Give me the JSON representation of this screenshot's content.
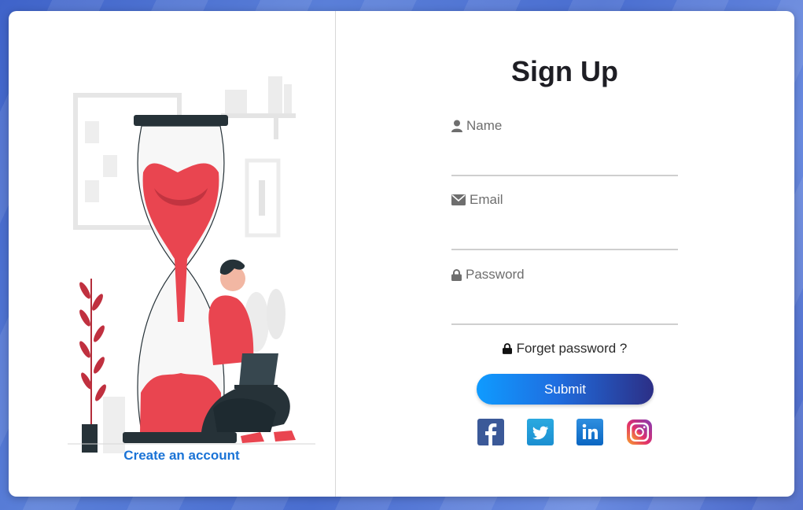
{
  "left": {
    "create_account_link": "Create an account"
  },
  "form": {
    "title": "Sign Up",
    "name_label": "Name",
    "email_label": "Email",
    "password_label": "Password",
    "name_value": "",
    "email_value": "",
    "password_value": "",
    "forgot_label": "Forget password ?",
    "submit_label": "Submit"
  },
  "social": [
    "facebook-icon",
    "twitter-icon",
    "linkedin-icon",
    "instagram-icon"
  ],
  "colors": {
    "link": "#1a73d6",
    "submit_start": "#0f9bff",
    "submit_end": "#2c2f86",
    "background": "#4a6ed0"
  }
}
